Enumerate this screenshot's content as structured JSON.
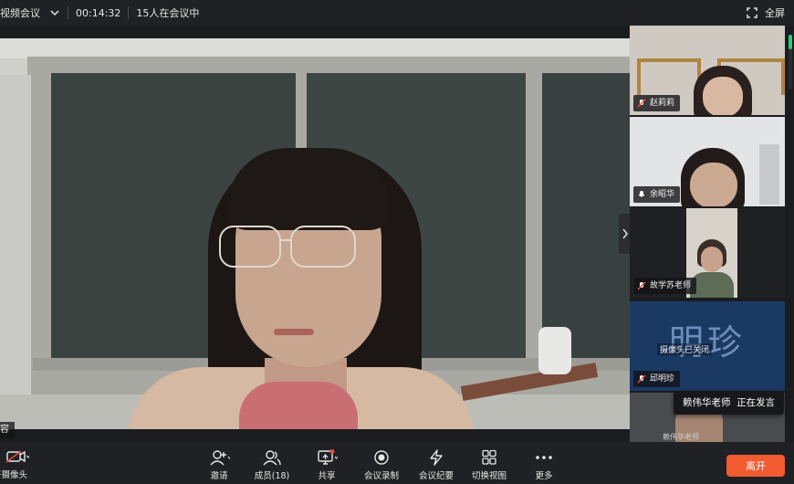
{
  "topbar": {
    "title": "视频会议",
    "timer": "00:14:32",
    "participants_status": "15人在会议中",
    "fullscreen_label": "全屏"
  },
  "main_video": {
    "name_tag": "容"
  },
  "sidebar": {
    "tiles": [
      {
        "name": "赵莉莉"
      },
      {
        "name": "余昭华"
      },
      {
        "name": "故学苏老师"
      },
      {
        "name": "邱明珍",
        "avatar_text": "明珍",
        "camera_off_text": "摄像头已关闭"
      },
      {
        "mini_text": "赖伟华老师"
      }
    ]
  },
  "speaking_banner": {
    "name": "赖伟华老师",
    "status": "正在发言"
  },
  "toolbar": {
    "camera_label": "开摄像头",
    "invite_label": "邀请",
    "members_label": "成员(18)",
    "share_label": "共享",
    "record_label": "会议录制",
    "minutes_label": "会议纪要",
    "view_label": "切换视图",
    "more_label": "更多",
    "leave_label": "离开"
  },
  "colors": {
    "leave_button": "#f25a30",
    "scroll_thumb": "#2ecc71",
    "share_dot": "#e74c3c"
  }
}
